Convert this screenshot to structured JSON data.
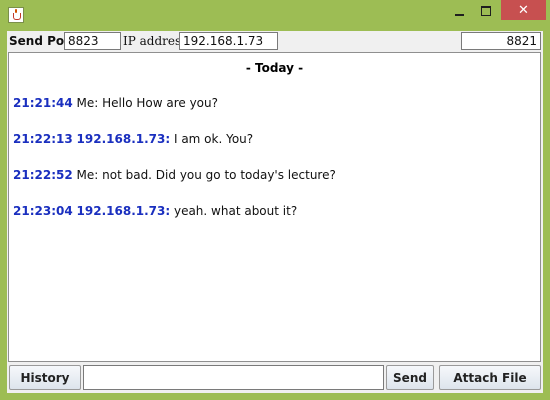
{
  "window": {
    "controls": {
      "minimize": "minimize",
      "maximize": "maximize",
      "close_glyph": "✕"
    }
  },
  "settings": {
    "send_port_label": "Send Port",
    "send_port_value": "8823",
    "ip_label": "IP address",
    "ip_value": "192.168.1.73",
    "listen_port_value": "8821"
  },
  "chat": {
    "day_header": "- Today -",
    "messages": [
      {
        "time": "21:21:44",
        "sender": "",
        "prefix": "Me:",
        "text": " Hello How are you?"
      },
      {
        "time": "21:22:13",
        "sender": "192.168.1.73:",
        "prefix": "",
        "text": " I am ok. You?"
      },
      {
        "time": "21:22:52",
        "sender": "",
        "prefix": "Me:",
        "text": " not bad. Did you go to today's lecture?"
      },
      {
        "time": "21:23:04",
        "sender": "192.168.1.73:",
        "prefix": "",
        "text": " yeah. what about it?"
      }
    ]
  },
  "bottom": {
    "history_label": "History",
    "message_value": "",
    "send_label": "Send",
    "attach_label": "Attach File"
  },
  "colors": {
    "title_bar": "#9dbd54",
    "close_button": "#c75050",
    "meta_text": "#1a2fbf"
  },
  "icons": {
    "app": "java-cup-icon",
    "minimize": "minimize-icon",
    "maximize": "maximize-icon",
    "close": "close-icon"
  }
}
